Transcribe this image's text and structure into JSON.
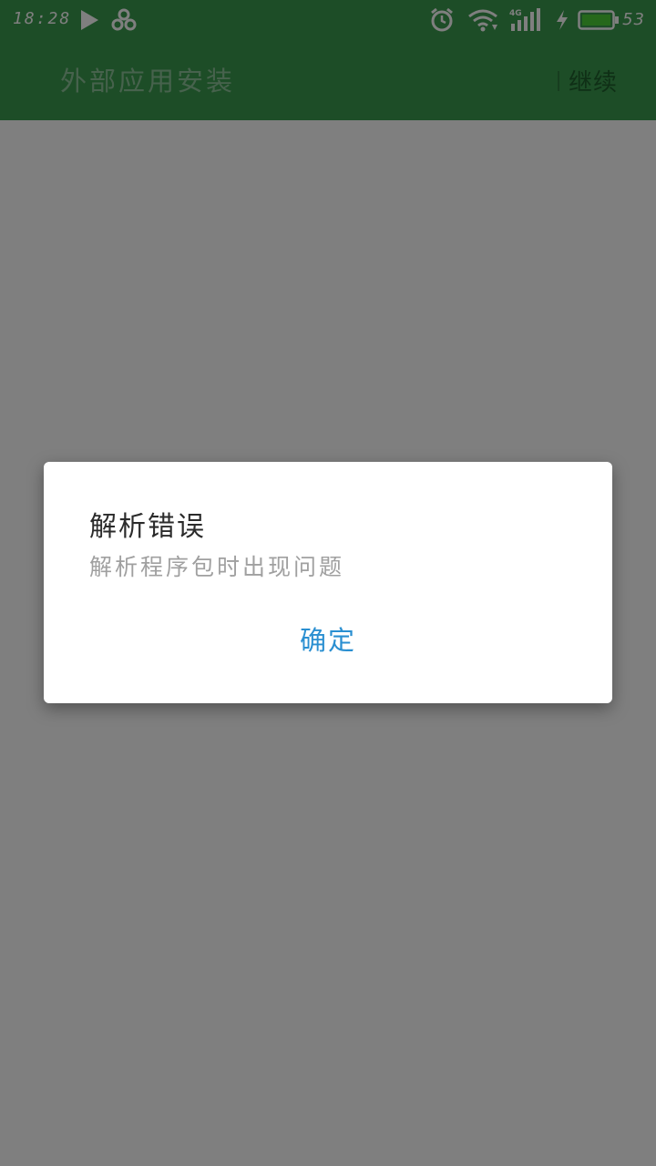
{
  "status_bar": {
    "time": "18:28",
    "battery_percent": "53",
    "network_label": "4G",
    "icons": [
      "play-icon",
      "cluster-icon",
      "alarm-icon",
      "wifi-icon",
      "signal-icon",
      "charging-icon",
      "battery-icon"
    ]
  },
  "app_bar": {
    "title": "外部应用安装",
    "continue_label": "继续"
  },
  "dialog": {
    "title": "解析错误",
    "message": "解析程序包时出现问题",
    "confirm_label": "确定"
  },
  "colors": {
    "app_bar": "#3b9a4e",
    "scrim": "#000000",
    "accent": "#2a8fd1",
    "battery_fill": "#4cd137"
  }
}
